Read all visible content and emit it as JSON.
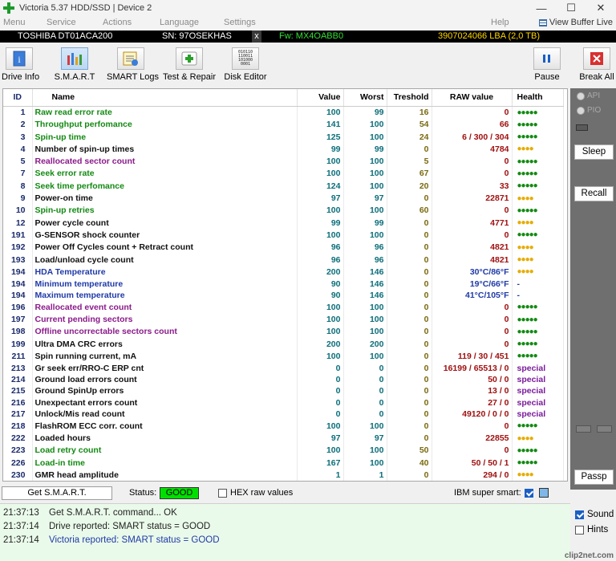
{
  "window": {
    "title": "Victoria 5.37 HDD/SSD | Device 2"
  },
  "menu": {
    "items": [
      "Menu",
      "Service",
      "Actions",
      "Language",
      "Settings",
      "Help"
    ],
    "buffer_live": "View Buffer Live"
  },
  "device": {
    "model": "TOSHIBA DT01ACA200",
    "serial": "SN: 97OSEKHAS",
    "close": "x",
    "firmware": "Fw: MX4OABB0",
    "capacity": "3907024066 LBA (2,0 TB)"
  },
  "toolbar": {
    "drive_info": "Drive Info",
    "smart": "S.M.A.R.T",
    "smart_logs": "SMART Logs",
    "test_repair": "Test & Repair",
    "disk_editor": "Disk Editor",
    "pause": "Pause",
    "break_all": "Break All",
    "disk_editor_glyph": "010110\n110011\n101000\n0001"
  },
  "table": {
    "headers": [
      "ID",
      "Name",
      "Value",
      "Worst",
      "Treshold",
      "RAW value",
      "Health"
    ],
    "rows": [
      {
        "id": "1",
        "name": "Raw read error rate",
        "value": "100",
        "worst": "99",
        "th": "16",
        "raw": "0",
        "health": "●●●●●",
        "nc": "green",
        "hc": "g"
      },
      {
        "id": "2",
        "name": "Throughput perfomance",
        "value": "141",
        "worst": "100",
        "th": "54",
        "raw": "66",
        "health": "●●●●●",
        "nc": "green",
        "hc": "g"
      },
      {
        "id": "3",
        "name": "Spin-up time",
        "value": "125",
        "worst": "100",
        "th": "24",
        "raw": "6 / 300 / 304",
        "health": "●●●●●",
        "nc": "green",
        "hc": "g"
      },
      {
        "id": "4",
        "name": "Number of spin-up times",
        "value": "99",
        "worst": "99",
        "th": "0",
        "raw": "4784",
        "health": "●●●●",
        "nc": "black",
        "hc": "y"
      },
      {
        "id": "5",
        "name": "Reallocated sector count",
        "value": "100",
        "worst": "100",
        "th": "5",
        "raw": "0",
        "health": "●●●●●",
        "nc": "purple",
        "hc": "g"
      },
      {
        "id": "7",
        "name": "Seek error rate",
        "value": "100",
        "worst": "100",
        "th": "67",
        "raw": "0",
        "health": "●●●●●",
        "nc": "green",
        "hc": "g"
      },
      {
        "id": "8",
        "name": "Seek time perfomance",
        "value": "124",
        "worst": "100",
        "th": "20",
        "raw": "33",
        "health": "●●●●●",
        "nc": "green",
        "hc": "g"
      },
      {
        "id": "9",
        "name": "Power-on time",
        "value": "97",
        "worst": "97",
        "th": "0",
        "raw": "22871",
        "health": "●●●●",
        "nc": "black",
        "hc": "y"
      },
      {
        "id": "10",
        "name": "Spin-up retries",
        "value": "100",
        "worst": "100",
        "th": "60",
        "raw": "0",
        "health": "●●●●●",
        "nc": "green",
        "hc": "g"
      },
      {
        "id": "12",
        "name": "Power cycle count",
        "value": "99",
        "worst": "99",
        "th": "0",
        "raw": "4771",
        "health": "●●●●",
        "nc": "black",
        "hc": "y"
      },
      {
        "id": "191",
        "name": "G-SENSOR shock counter",
        "value": "100",
        "worst": "100",
        "th": "0",
        "raw": "0",
        "health": "●●●●●",
        "nc": "black",
        "hc": "g"
      },
      {
        "id": "192",
        "name": "Power Off Cycles count + Retract count",
        "value": "96",
        "worst": "96",
        "th": "0",
        "raw": "4821",
        "health": "●●●●",
        "nc": "black",
        "hc": "y"
      },
      {
        "id": "193",
        "name": "Load/unload cycle count",
        "value": "96",
        "worst": "96",
        "th": "0",
        "raw": "4821",
        "health": "●●●●",
        "nc": "black",
        "hc": "y"
      },
      {
        "id": "194",
        "name": "HDA Temperature",
        "value": "200",
        "worst": "146",
        "th": "0",
        "raw": "30°C/86°F",
        "health": "●●●●",
        "nc": "blue",
        "hc": "y",
        "rb": true
      },
      {
        "id": "194",
        "name": "Minimum temperature",
        "value": "90",
        "worst": "146",
        "th": "0",
        "raw": "19°C/66°F",
        "health": "-",
        "nc": "blue",
        "hc": "d",
        "rb": true
      },
      {
        "id": "194",
        "name": "Maximum temperature",
        "value": "90",
        "worst": "146",
        "th": "0",
        "raw": "41°C/105°F",
        "health": "-",
        "nc": "blue",
        "hc": "d",
        "rb": true
      },
      {
        "id": "196",
        "name": "Reallocated event count",
        "value": "100",
        "worst": "100",
        "th": "0",
        "raw": "0",
        "health": "●●●●●",
        "nc": "purple",
        "hc": "g"
      },
      {
        "id": "197",
        "name": "Current pending sectors",
        "value": "100",
        "worst": "100",
        "th": "0",
        "raw": "0",
        "health": "●●●●●",
        "nc": "purple",
        "hc": "g"
      },
      {
        "id": "198",
        "name": "Offline uncorrectable sectors count",
        "value": "100",
        "worst": "100",
        "th": "0",
        "raw": "0",
        "health": "●●●●●",
        "nc": "purple",
        "hc": "g"
      },
      {
        "id": "199",
        "name": "Ultra DMA CRC errors",
        "value": "200",
        "worst": "200",
        "th": "0",
        "raw": "0",
        "health": "●●●●●",
        "nc": "black",
        "hc": "g"
      },
      {
        "id": "211",
        "name": "Spin running current, mA",
        "value": "100",
        "worst": "100",
        "th": "0",
        "raw": "119 / 30 / 451",
        "health": "●●●●●",
        "nc": "black",
        "hc": "g"
      },
      {
        "id": "213",
        "name": "Gr seek err/RRO-C ERP cnt",
        "value": "0",
        "worst": "0",
        "th": "0",
        "raw": "16199 / 65513 / 0",
        "health": "special",
        "nc": "black",
        "hc": "s"
      },
      {
        "id": "214",
        "name": "Ground load errors count",
        "value": "0",
        "worst": "0",
        "th": "0",
        "raw": "50 / 0",
        "health": "special",
        "nc": "black",
        "hc": "s"
      },
      {
        "id": "215",
        "name": "Ground SpinUp errors",
        "value": "0",
        "worst": "0",
        "th": "0",
        "raw": "13 / 0",
        "health": "special",
        "nc": "black",
        "hc": "s"
      },
      {
        "id": "216",
        "name": "Unexpectant errors count",
        "value": "0",
        "worst": "0",
        "th": "0",
        "raw": "27 / 0",
        "health": "special",
        "nc": "black",
        "hc": "s"
      },
      {
        "id": "217",
        "name": "Unlock/Mis read count",
        "value": "0",
        "worst": "0",
        "th": "0",
        "raw": "49120 / 0 / 0",
        "health": "special",
        "nc": "black",
        "hc": "s"
      },
      {
        "id": "218",
        "name": "FlashROM ECC corr. count",
        "value": "100",
        "worst": "100",
        "th": "0",
        "raw": "0",
        "health": "●●●●●",
        "nc": "black",
        "hc": "g"
      },
      {
        "id": "222",
        "name": "Loaded hours",
        "value": "97",
        "worst": "97",
        "th": "0",
        "raw": "22855",
        "health": "●●●●",
        "nc": "black",
        "hc": "y"
      },
      {
        "id": "223",
        "name": "Load retry count",
        "value": "100",
        "worst": "100",
        "th": "50",
        "raw": "0",
        "health": "●●●●●",
        "nc": "green",
        "hc": "g"
      },
      {
        "id": "226",
        "name": "Load-in time",
        "value": "167",
        "worst": "100",
        "th": "40",
        "raw": "50 / 50 / 1",
        "health": "●●●●●",
        "nc": "green",
        "hc": "g"
      },
      {
        "id": "230",
        "name": "GMR head amplitude",
        "value": "1",
        "worst": "1",
        "th": "0",
        "raw": "294 / 0",
        "health": "●●●●",
        "nc": "black",
        "hc": "y"
      }
    ]
  },
  "right_panel": {
    "api": "API",
    "pio": "PIO",
    "sleep": "Sleep",
    "recall": "Recall",
    "passp": "Passp"
  },
  "status_bar": {
    "get_smart": "Get S.M.A.R.T.",
    "status_label": "Status:",
    "status_value": "GOOD",
    "hex_raw": "HEX raw values",
    "ibm_super_smart": "IBM super smart:"
  },
  "log": [
    {
      "time": "21:37:13",
      "msg": "Get S.M.A.R.T. command... OK"
    },
    {
      "time": "21:37:14",
      "msg": "Drive reported: SMART status = GOOD"
    },
    {
      "time": "21:37:14",
      "msg": "Victoria reported: SMART status = GOOD"
    }
  ],
  "options": {
    "sound": "Sound",
    "hints": "Hints",
    "watermark": "clip2net.com"
  },
  "colors": {
    "status_good": "#00e000",
    "device_bar_bg": "#000000",
    "model_color": "#ffffff",
    "serial_color": "#ffffff",
    "fw_color": "#33e033",
    "capacity_color": "#ffd700"
  }
}
